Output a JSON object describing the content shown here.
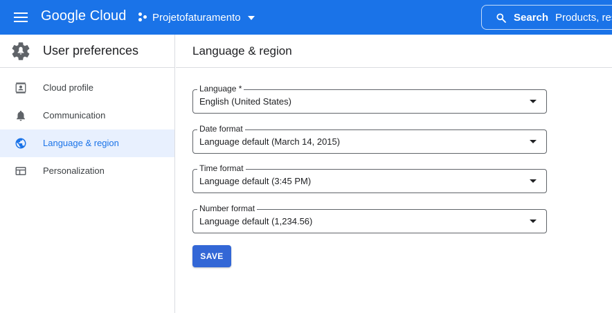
{
  "topbar": {
    "brand": "Google Cloud",
    "project": "Projetofaturamento",
    "search_label": "Search",
    "search_placeholder": "Products, res"
  },
  "sidebar": {
    "title": "User preferences",
    "items": [
      {
        "label": "Cloud profile",
        "icon": "profile-card-icon",
        "active": false
      },
      {
        "label": "Communication",
        "icon": "bell-icon",
        "active": false
      },
      {
        "label": "Language & region",
        "icon": "globe-icon",
        "active": true
      },
      {
        "label": "Personalization",
        "icon": "layout-icon",
        "active": false
      }
    ]
  },
  "main": {
    "title": "Language & region",
    "fields": [
      {
        "label": "Language *",
        "value": "English (United States)"
      },
      {
        "label": "Date format",
        "value": "Language default (March 14, 2015)"
      },
      {
        "label": "Time format",
        "value": "Language default (3:45 PM)"
      },
      {
        "label": "Number format",
        "value": "Language default (1,234.56)"
      }
    ],
    "save_label": "SAVE"
  },
  "colors": {
    "brand_blue": "#1a73e8",
    "active_bg": "#e8f0fe",
    "button_blue": "#3367d6"
  }
}
